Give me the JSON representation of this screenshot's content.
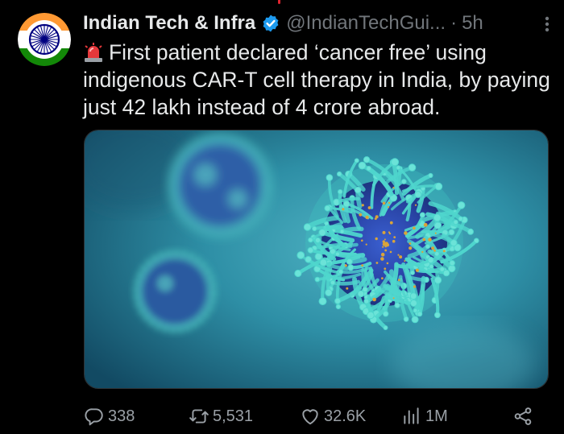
{
  "tweet": {
    "author": {
      "display_name": "Indian Tech & Infra",
      "handle": "@IndianTechGui...",
      "verified": true,
      "avatar_icon": "india-emblem-icon"
    },
    "separator": "·",
    "time": "5h",
    "text_emoji": "siren-icon",
    "text": "First patient declared ‘cancer free’ using indigenous CAR-T cell therapy in India, by paying just 42 lakh instead of 4 crore abroad.",
    "media": {
      "kind": "image",
      "depicts": "t-cell-illustration"
    },
    "actions": {
      "replies": "338",
      "reposts": "5,531",
      "likes": "32.6K",
      "views": "1M"
    }
  },
  "colors": {
    "background": "#000000",
    "text_primary": "#e7e9ea",
    "text_secondary": "#71767b",
    "verified_blue": "#1d9bf0",
    "saffron": "#ff9933",
    "india_green": "#138808",
    "chakra_blue": "#000080"
  }
}
